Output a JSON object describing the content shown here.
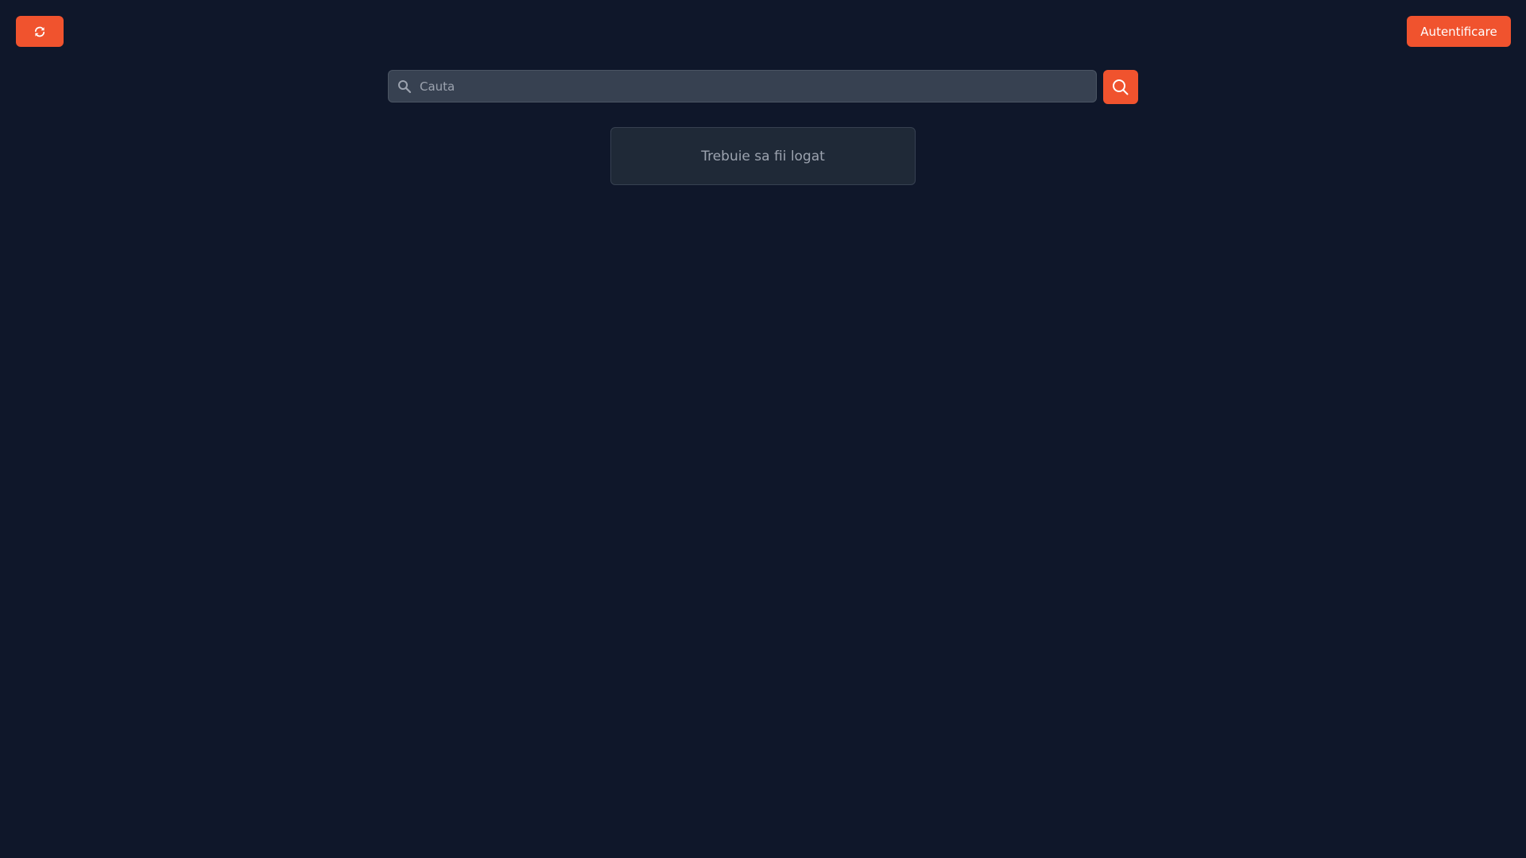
{
  "header": {
    "refresh_icon": "refresh-icon",
    "login_label": "Autentificare"
  },
  "search": {
    "placeholder": "Cauta",
    "value": "",
    "lead_icon": "search-icon",
    "button_icon": "search-icon"
  },
  "notice": {
    "message": "Trebuie sa fii logat"
  },
  "colors": {
    "background": "#0f172a",
    "accent": "#f0532e",
    "input_bg": "#374151",
    "panel_bg": "#1f2937",
    "muted_text": "#9ca3af"
  }
}
